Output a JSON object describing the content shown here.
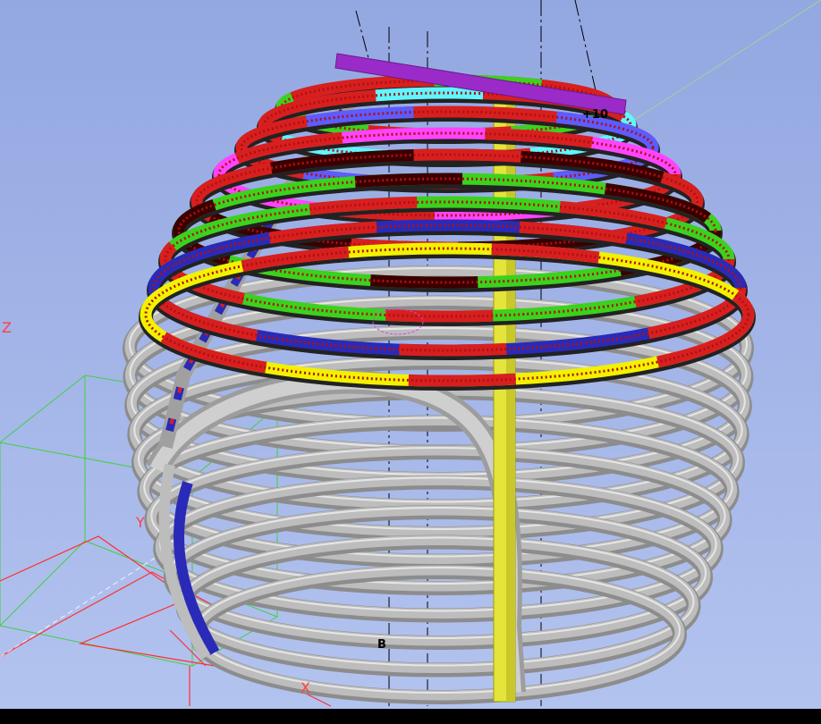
{
  "viewport": {
    "gridline_label_b": "B",
    "elevation_label": "+10",
    "axes": {
      "x": "X",
      "y": "Y",
      "z": "Z"
    }
  },
  "colors": {
    "background_top": "#94a8e2",
    "background_bottom": "#aebfee",
    "member_gray": "#bdbdbd",
    "member_gray_edge": "#e6e6e6",
    "ring_colors": [
      "#d81f1f",
      "#f2f200",
      "#2a2ab8",
      "#3bd21e",
      "#3a0000",
      "#ff44ff",
      "#5c5cff",
      "#5ff6ff",
      "#9a2bc8"
    ],
    "column_yellow": "#e4e43a",
    "axis_red": "#ff3030",
    "axis_green": "#40d040"
  },
  "bottom_bar": {
    "text": ""
  }
}
